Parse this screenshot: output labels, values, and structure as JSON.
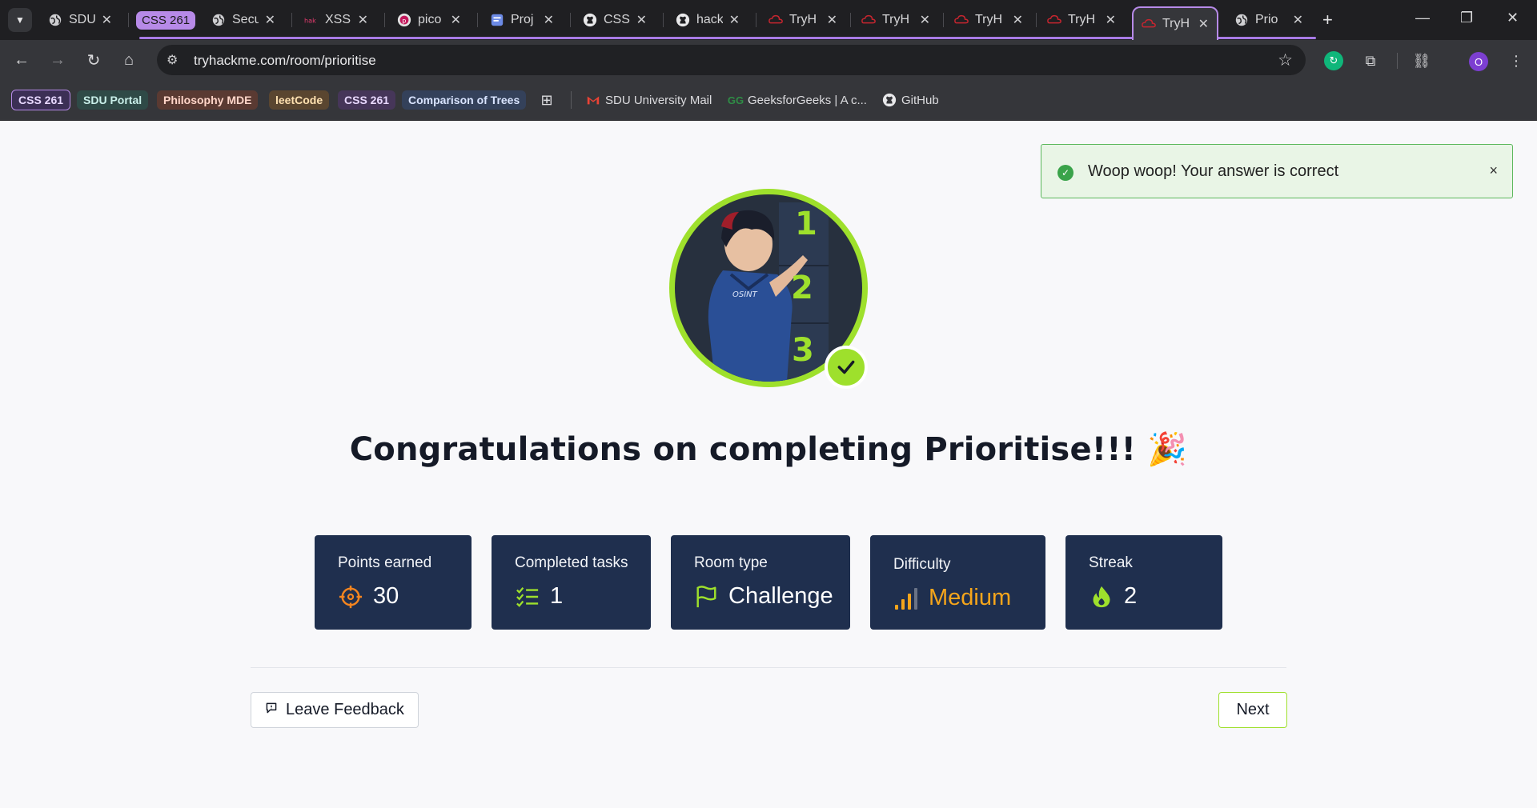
{
  "browser": {
    "tabs": [
      {
        "title": "SDU",
        "icon": "globe-icon"
      },
      {
        "group": "CSS 261"
      },
      {
        "title": "Secu",
        "icon": "globe-icon"
      },
      {
        "title": "XSS",
        "icon": "xss-icon"
      },
      {
        "title": "pico",
        "icon": "picoctf-icon"
      },
      {
        "title": "Proj",
        "icon": "project-icon"
      },
      {
        "title": "CSS",
        "icon": "github-icon"
      },
      {
        "title": "hack",
        "icon": "github-icon"
      },
      {
        "title": "TryH",
        "icon": "tryhackme-icon"
      },
      {
        "title": "TryH",
        "icon": "tryhackme-icon"
      },
      {
        "title": "TryH",
        "icon": "tryhackme-icon"
      },
      {
        "title": "TryH",
        "icon": "tryhackme-icon"
      },
      {
        "title": "TryH",
        "icon": "tryhackme-icon",
        "active": true
      },
      {
        "title": "Prio",
        "icon": "globe-icon"
      }
    ],
    "url": "tryhackme.com/room/prioritise",
    "profile_initial": "O",
    "bookmarks": [
      {
        "label": "CSS 261",
        "type": "group",
        "color": "#b78ae8"
      },
      {
        "label": "SDU Portal",
        "type": "group",
        "color": "#8fd0c6"
      },
      {
        "label": "Philosophy MDE",
        "type": "group",
        "color": "#f3a38b"
      },
      {
        "label": "leetCode",
        "type": "group",
        "color": "#f0c37c"
      },
      {
        "label": "CSS 261",
        "type": "group",
        "color": "#c5a3f0"
      },
      {
        "label": "Comparison of Trees",
        "type": "group",
        "color": "#9fb8e8"
      },
      {
        "label": "SDU University Mail",
        "type": "link",
        "icon": "gmail-icon"
      },
      {
        "label": "GeeksforGeeks | A c...",
        "type": "link",
        "icon": "geeksforgeeks-icon"
      },
      {
        "label": "GitHub",
        "type": "link",
        "icon": "github-icon"
      }
    ]
  },
  "toast": {
    "message": "Woop woop! Your answer is correct",
    "close": "×"
  },
  "badge": {
    "numbers": [
      "1",
      "2",
      "3"
    ],
    "figure_text": "OSINT"
  },
  "heading": "Congratulations on completing Prioritise!!! 🎉",
  "stats": [
    {
      "label": "Points earned",
      "value": "30",
      "icon": "crosshair-icon",
      "color": "#f5851f"
    },
    {
      "label": "Completed tasks",
      "value": "1",
      "icon": "checklist-icon",
      "color": "#9ee02c"
    },
    {
      "label": "Room type",
      "value": "Challenge",
      "icon": "flag-icon",
      "color": "#9ee02c"
    },
    {
      "label": "Difficulty",
      "value": "Medium",
      "icon": "signal-bars-icon",
      "color": "#f5a51b"
    },
    {
      "label": "Streak",
      "value": "2",
      "icon": "flame-icon",
      "color": "#9ee02c"
    }
  ],
  "actions": {
    "feedback_label": "Leave Feedback",
    "next_label": "Next"
  },
  "colors": {
    "accent_green": "#9ee02c",
    "card_navy": "#1f2f4e",
    "tab_group_purple": "#b78ae8"
  }
}
